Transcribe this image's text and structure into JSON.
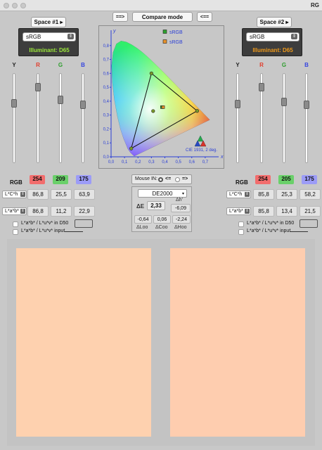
{
  "window": {
    "title": "RG"
  },
  "toolbar": {
    "left_arrow": "==>",
    "compare_mode": "Compare mode",
    "right_arrow": "<=="
  },
  "space1": {
    "title": "Space #1",
    "profile": "sRGB",
    "illuminant": "Illuminant: D65",
    "illuminant_color": "#9be83a",
    "channels": [
      {
        "label": "Y",
        "color": "#222222",
        "level": 0.68
      },
      {
        "label": "R",
        "color": "#e23b2a",
        "level": 0.88
      },
      {
        "label": "G",
        "color": "#2e9e2e",
        "level": 0.72
      },
      {
        "label": "B",
        "color": "#3444e0",
        "level": 0.66
      }
    ],
    "rgb_label": "RGB",
    "rgb": [
      "254",
      "209",
      "175"
    ],
    "lch_mode": "L*C*h",
    "lch": [
      "86,8",
      "25,5",
      "63,9"
    ],
    "lab_mode": "L*a*b*",
    "lab": [
      "86,8",
      "11,2",
      "22,9"
    ],
    "check_d50": "L*a*b* / L*u*v* in D50",
    "check_input": "L*a*b* / L*u*v* input",
    "swatch_color": "#fed1af"
  },
  "space2": {
    "title": "Space #2",
    "profile": "sRGB",
    "illuminant": "Illuminant: D65",
    "illuminant_color": "#f09a1a",
    "channels": [
      {
        "label": "Y",
        "color": "#222222",
        "level": 0.67
      },
      {
        "label": "R",
        "color": "#e23b2a",
        "level": 0.88
      },
      {
        "label": "G",
        "color": "#2e9e2e",
        "level": 0.7
      },
      {
        "label": "B",
        "color": "#3444e0",
        "level": 0.66
      }
    ],
    "rgb_label": "RGB",
    "rgb": [
      "254",
      "205",
      "175"
    ],
    "lch_mode": "L*C*h",
    "lch": [
      "85,8",
      "25,3",
      "58,2"
    ],
    "lab_mode": "L*a*b*",
    "lab": [
      "85,8",
      "13,4",
      "21,5"
    ],
    "check_d50": "L*a*b* / L*u*v* in D50",
    "check_input": "L*a*b* / L*u*v* input",
    "swatch_color": "#fecdaf"
  },
  "chart_data": {
    "type": "scatter",
    "caption": "CIE 1931, 2 deg.",
    "xlabel": "x",
    "ylabel": "y",
    "xlim": [
      0,
      0.8
    ],
    "ylim": [
      0,
      0.9
    ],
    "x_ticks": [
      "0,0",
      "0,1",
      "0,2",
      "0,3",
      "0,4",
      "0,5",
      "0,6",
      "0,7"
    ],
    "y_ticks": [
      "0,0",
      "0,1",
      "0,2",
      "0,3",
      "0,4",
      "0,5",
      "0,6",
      "0,7",
      "0,8"
    ],
    "legend": [
      {
        "name": "sRGB",
        "color": "#2ea32e"
      },
      {
        "name": "sRGB",
        "color": "#e8912a"
      }
    ],
    "gamut_triangle": [
      [
        0.64,
        0.33
      ],
      [
        0.3,
        0.6
      ],
      [
        0.15,
        0.06
      ]
    ],
    "white_point": [
      0.3127,
      0.329
    ],
    "color_points": [
      {
        "series": 0,
        "x": 0.378,
        "y": 0.357
      },
      {
        "series": 1,
        "x": 0.381,
        "y": 0.357
      }
    ]
  },
  "compare": {
    "mouse_label": "Mouse IN:",
    "mouse_opt1": "<=",
    "mouse_opt2": "=>",
    "formula": "DE2000",
    "delta_e_label": "ΔE",
    "delta_e": "2,33",
    "dh_label": "Δh'",
    "dh": "-6,09",
    "dl": "-0,64",
    "dc": "0,06",
    "dhoo": "-2,24",
    "dl_label": "ΔLoo",
    "dc_label": "ΔCoo",
    "dhoo_label": "ΔHoo"
  }
}
